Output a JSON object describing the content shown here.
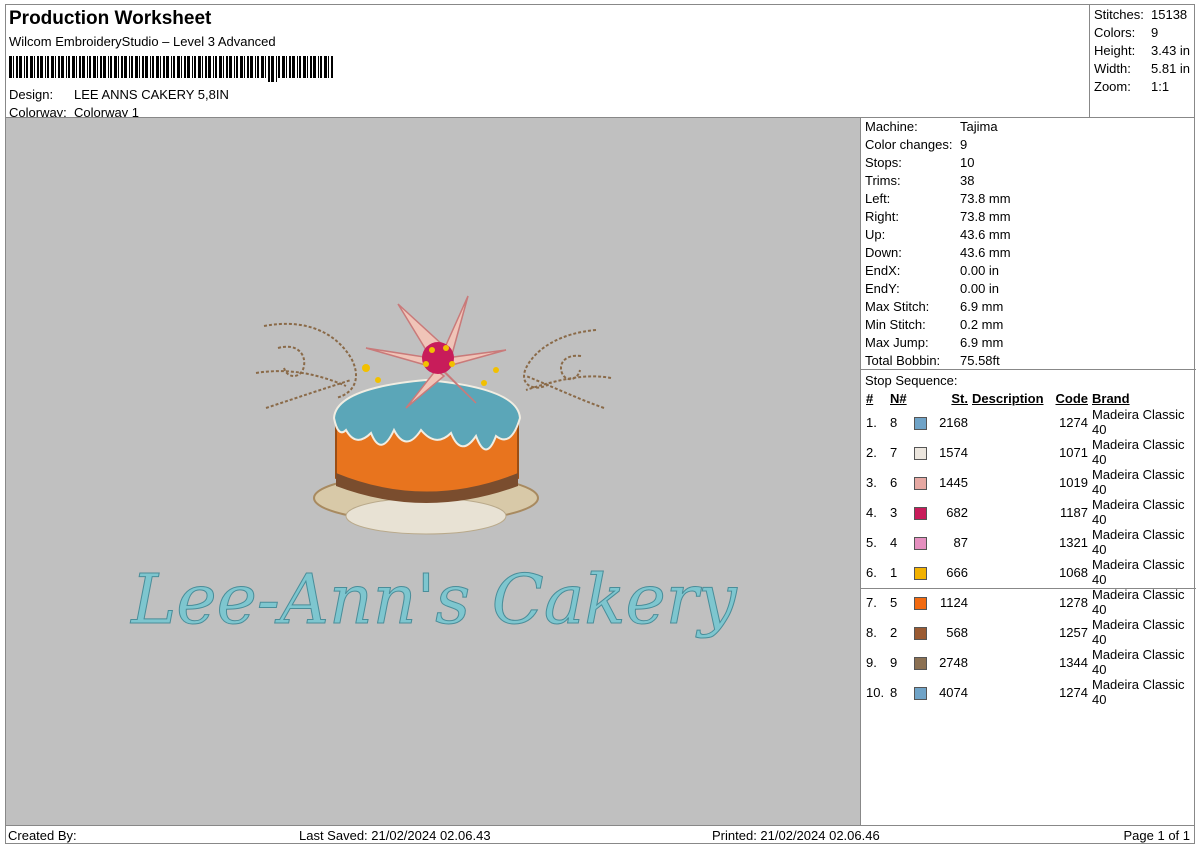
{
  "header": {
    "title": "Production Worksheet",
    "subtitle": "Wilcom EmbroideryStudio – Level 3 Advanced",
    "design_label": "Design:",
    "design_value": "LEE ANNS CAKERY 5,8IN",
    "colorway_label": "Colorway:",
    "colorway_value": "Colorway 1"
  },
  "stats": [
    {
      "label": "Stitches:",
      "value": "15138"
    },
    {
      "label": "Colors:",
      "value": "9"
    },
    {
      "label": "Height:",
      "value": "3.43 in"
    },
    {
      "label": "Width:",
      "value": "5.81 in"
    },
    {
      "label": "Zoom:",
      "value": "1:1"
    }
  ],
  "machine": [
    {
      "label": "Machine:",
      "value": "Tajima"
    },
    {
      "label": "Color changes:",
      "value": "9"
    },
    {
      "label": "Stops:",
      "value": "10"
    },
    {
      "label": "Trims:",
      "value": "38"
    },
    {
      "label": "Left:",
      "value": "73.8 mm"
    },
    {
      "label": "Right:",
      "value": "73.8 mm"
    },
    {
      "label": "Up:",
      "value": "43.6 mm"
    },
    {
      "label": "Down:",
      "value": "43.6 mm"
    },
    {
      "label": "EndX:",
      "value": "0.00 in"
    },
    {
      "label": "EndY:",
      "value": "0.00 in"
    },
    {
      "label": "Max Stitch:",
      "value": "6.9 mm"
    },
    {
      "label": "Min Stitch:",
      "value": "0.2 mm"
    },
    {
      "label": "Max Jump:",
      "value": "6.9 mm"
    },
    {
      "label": "Total Bobbin:",
      "value": "75.58ft"
    }
  ],
  "stop_sequence": {
    "label": "Stop Sequence:",
    "headers": {
      "idx": "#",
      "n": "N#",
      "st": "St.",
      "desc": "Description",
      "code": "Code",
      "brand": "Brand"
    },
    "rows": [
      {
        "idx": "1.",
        "n": "8",
        "color": "#6fa3c7",
        "st": "2168",
        "desc": "",
        "code": "1274",
        "brand": "Madeira Classic 40"
      },
      {
        "idx": "2.",
        "n": "7",
        "color": "#ece6de",
        "st": "1574",
        "desc": "",
        "code": "1071",
        "brand": "Madeira Classic 40"
      },
      {
        "idx": "3.",
        "n": "6",
        "color": "#e6a8a2",
        "st": "1445",
        "desc": "",
        "code": "1019",
        "brand": "Madeira Classic 40"
      },
      {
        "idx": "4.",
        "n": "3",
        "color": "#c81c5a",
        "st": "682",
        "desc": "",
        "code": "1187",
        "brand": "Madeira Classic 40"
      },
      {
        "idx": "5.",
        "n": "4",
        "color": "#e58fbf",
        "st": "87",
        "desc": "",
        "code": "1321",
        "brand": "Madeira Classic 40"
      },
      {
        "idx": "6.",
        "n": "1",
        "color": "#f2b100",
        "st": "666",
        "desc": "",
        "code": "1068",
        "brand": "Madeira Classic 40"
      },
      {
        "idx": "7.",
        "n": "5",
        "color": "#f26a10",
        "st": "1124",
        "desc": "",
        "code": "1278",
        "brand": "Madeira Classic 40"
      },
      {
        "idx": "8.",
        "n": "2",
        "color": "#9a5a32",
        "st": "568",
        "desc": "",
        "code": "1257",
        "brand": "Madeira Classic 40"
      },
      {
        "idx": "9.",
        "n": "9",
        "color": "#8b7052",
        "st": "2748",
        "desc": "",
        "code": "1344",
        "brand": "Madeira Classic 40"
      },
      {
        "idx": "10.",
        "n": "8",
        "color": "#6fa3c7",
        "st": "4074",
        "desc": "",
        "code": "1274",
        "brand": "Madeira Classic 40"
      }
    ]
  },
  "design_preview": {
    "logo_text": "Lee-Ann's Cakery",
    "background": "#c0c0c0"
  },
  "footer": {
    "created_by": "Created By:",
    "last_saved": "Last Saved: 21/02/2024 02.06.43",
    "printed": "Printed: 21/02/2024 02.06.46",
    "page": "Page 1 of 1"
  }
}
